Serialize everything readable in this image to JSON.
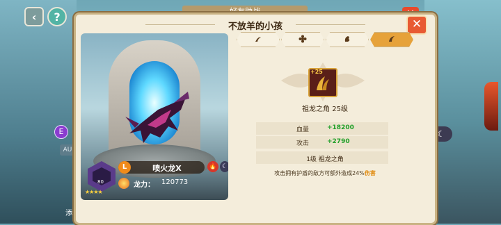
{
  "background": {
    "title": "好友助战",
    "left_side": {
      "e_badge": "E",
      "au_label": "AU",
      "add_label": "添加"
    },
    "right_btn_icon": "moon-icon"
  },
  "panel": {
    "title": "不放羊的小孩",
    "close_label": "✕"
  },
  "pet": {
    "name": "喷火龙X",
    "rarity": "L",
    "level": "80",
    "stars": "★★★★",
    "element_fire": "🔥",
    "element_moon": "☾",
    "power_label": "龙力：",
    "power_value": "120773"
  },
  "tabs": [
    {
      "icon": "claw-icon",
      "active": false
    },
    {
      "icon": "flower-icon",
      "active": false
    },
    {
      "icon": "dragon-icon",
      "active": false
    },
    {
      "icon": "horn-icon",
      "active": true
    }
  ],
  "equipment": {
    "level_badge": "+25",
    "name_level": "祖龙之角 25级",
    "stats": [
      {
        "label": "血量",
        "value": "+18200"
      },
      {
        "label": "攻击",
        "value": "+2790"
      }
    ],
    "skill_title": "1级 祖龙之角",
    "skill_desc_prefix": "攻击拥有护盾的敌方可额外造成24%",
    "skill_desc_highlight": "伤害"
  },
  "colors": {
    "accent": "#e6a23a",
    "close": "#e85a33",
    "stat_green": "#22a02a"
  }
}
